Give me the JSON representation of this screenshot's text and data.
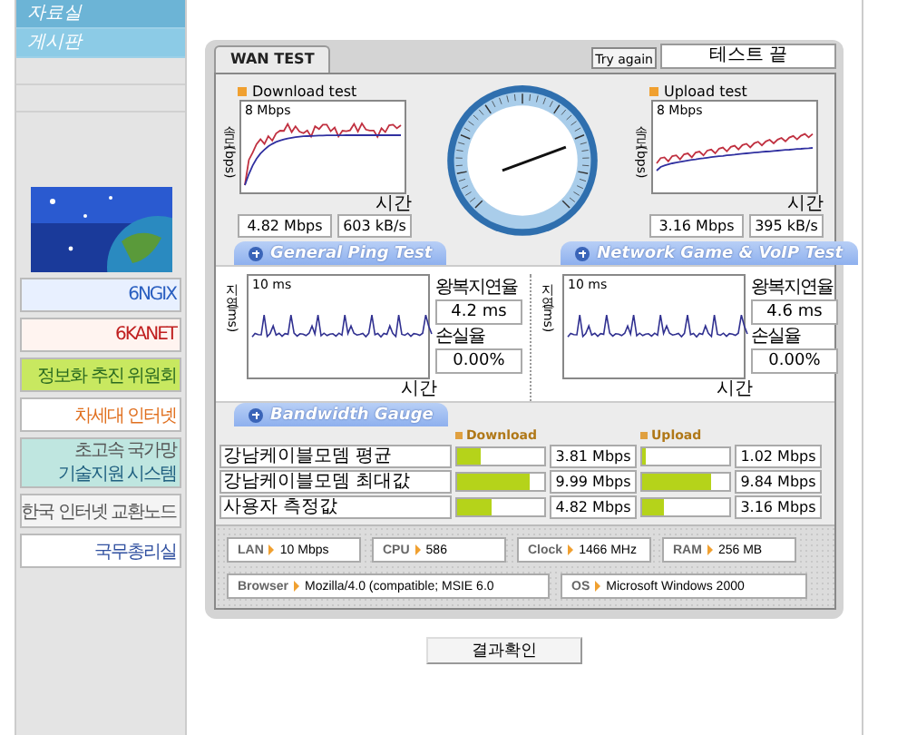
{
  "sidebar": {
    "menu": [
      {
        "label": "자료실"
      },
      {
        "label": "게시판"
      }
    ],
    "banners": [
      {
        "kind": "picture"
      },
      {
        "kind": "banner",
        "label": "6NGIX"
      },
      {
        "kind": "banner",
        "label": "6KANET"
      },
      {
        "kind": "banner",
        "label": "정보화 추진 위원회"
      },
      {
        "kind": "banner",
        "label": "차세대 인터넷"
      },
      {
        "kind": "banner",
        "caption": "초고속 국가망",
        "label": "기술지원 시스템"
      },
      {
        "kind": "banner",
        "label": "한국 인터넷 교환노드"
      },
      {
        "kind": "banner",
        "label": "국무총리실"
      }
    ]
  },
  "panel": {
    "tabs": [
      {
        "label": "WAN TEST",
        "selected": true
      }
    ],
    "try_again": "Try again",
    "status": "테스트 끝",
    "download": {
      "title": "Download test",
      "scale": "8 Mbps",
      "y_label": "속도 (bps)",
      "x_label": "시간",
      "rate": "4.82 Mbps",
      "bytes": "603 kB/s"
    },
    "upload": {
      "title": "Upload test",
      "scale": "8 Mbps",
      "y_label": "속도 (bps)",
      "x_label": "시간",
      "rate": "3.16 Mbps",
      "bytes": "395 kB/s"
    },
    "ping_tests": [
      {
        "title": "General Ping Test",
        "scale": "10 ms",
        "y_label": "지연 (ms)",
        "x_label": "시간",
        "latency_label": "왕복지연율",
        "latency": "4.2 ms",
        "loss_label": "손실율",
        "loss": "0.00%"
      },
      {
        "title": "Network Game & VoIP Test",
        "scale": "10 ms",
        "y_label": "지연 (ms)",
        "x_label": "시간",
        "latency_label": "왕복지연율",
        "latency": "4.6 ms",
        "loss_label": "손실율",
        "loss": "0.00%"
      }
    ],
    "bandwidth": {
      "title": "Bandwidth Gauge",
      "download_header": "Download",
      "upload_header": "Upload",
      "rows": [
        {
          "label": "강남케이블모뎀 평균",
          "download": {
            "level": 0.27,
            "reading": "3.81 Mbps"
          },
          "upload": {
            "level": 0.05,
            "reading": "1.02 Mbps"
          }
        },
        {
          "label": "강남케이블모뎀 최대값",
          "download": {
            "level": 0.83,
            "reading": "9.99 Mbps"
          },
          "upload": {
            "level": 0.8,
            "reading": "9.84 Mbps"
          }
        },
        {
          "label": "사용자 측정값",
          "download": {
            "level": 0.4,
            "reading": "4.82 Mbps"
          },
          "upload": {
            "level": 0.26,
            "reading": "3.16 Mbps"
          }
        }
      ]
    },
    "system": [
      {
        "label": "LAN",
        "value": "10 Mbps"
      },
      {
        "label": "CPU",
        "value": "586"
      },
      {
        "label": "Clock",
        "value": "1466 MHz"
      },
      {
        "label": "RAM",
        "value": "256 MB"
      },
      {
        "label": "Browser",
        "value": "Mozilla/4.0 (compatible; MSIE 6.0"
      },
      {
        "label": "OS",
        "value": "Microsoft Windows 2000"
      }
    ]
  },
  "result_button": "결과확인"
}
